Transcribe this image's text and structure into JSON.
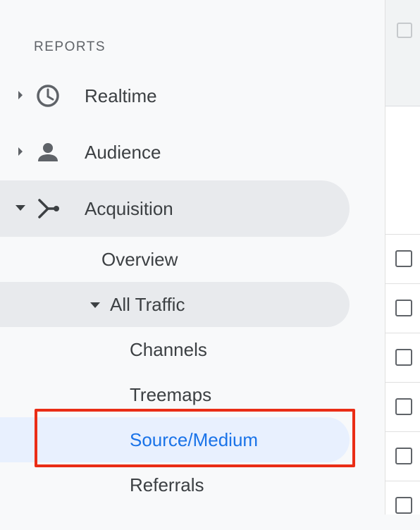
{
  "sidebar": {
    "section_title": "REPORTS",
    "items": [
      {
        "label": "Realtime",
        "icon": "clock-icon",
        "expanded": false
      },
      {
        "label": "Audience",
        "icon": "person-icon",
        "expanded": false
      },
      {
        "label": "Acquisition",
        "icon": "acquisition-icon",
        "expanded": true,
        "children": [
          {
            "label": "Overview"
          },
          {
            "label": "All Traffic",
            "expanded": true,
            "children": [
              {
                "label": "Channels"
              },
              {
                "label": "Treemaps"
              },
              {
                "label": "Source/Medium",
                "selected": true
              },
              {
                "label": "Referrals"
              }
            ]
          }
        ]
      }
    ]
  },
  "colors": {
    "text": "#3c4043",
    "icon": "#5f6368",
    "selected_text": "#1a73e8",
    "selected_bg": "#e8f0fe",
    "active_bg": "#e8eaed",
    "highlight_border": "#ea2d16"
  }
}
